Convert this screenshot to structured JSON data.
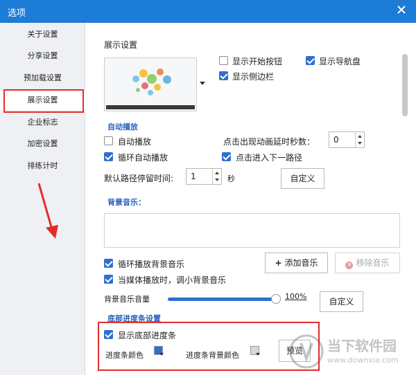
{
  "window": {
    "title": "选项"
  },
  "sidebar": {
    "items": [
      {
        "label": "关于设置"
      },
      {
        "label": "分享设置"
      },
      {
        "label": "预加载设置"
      },
      {
        "label": "展示设置"
      },
      {
        "label": "企业标志"
      },
      {
        "label": "加密设置"
      },
      {
        "label": "排练计时"
      }
    ],
    "active_index": 3
  },
  "display": {
    "section_title": "展示设置",
    "show_start_button": {
      "label": "显示开始按钮",
      "checked": false
    },
    "show_nav_panel": {
      "label": "显示导航盘",
      "checked": true
    },
    "show_sidebar": {
      "label": "显示侧边栏",
      "checked": true
    }
  },
  "autoplay": {
    "section_title": "自动播放",
    "auto_play": {
      "label": "自动播放",
      "checked": false
    },
    "loop_auto_play": {
      "label": "循环自动播放",
      "checked": true
    },
    "delay_label": "点击出现动画延时秒数：",
    "delay_value": "0",
    "click_next_path": {
      "label": "点击进入下一路径",
      "checked": true
    },
    "default_stay_label": "默认路径停留时间:",
    "default_stay_value": "1",
    "seconds_unit": "秒",
    "custom_button": "自定义"
  },
  "music": {
    "section_title": "背景音乐：",
    "loop_music": {
      "label": "循环播放背景音乐",
      "checked": true
    },
    "lower_music": {
      "label": "当媒体播放时，调小背景音乐",
      "checked": true
    },
    "add_button": "添加音乐",
    "remove_button": "移除音乐",
    "volume_label": "背景音乐音量",
    "volume_value": "100%",
    "volume_fraction": 1.0,
    "custom_button": "自定义"
  },
  "progress": {
    "section_title": "底部进度条设置",
    "show_progress": {
      "label": "显示底部进度条",
      "checked": true
    },
    "bar_color_label": "进度条颜色",
    "bar_color": "#2f6fd0",
    "bg_color_label": "进度条背景颜色",
    "bg_color": "#d8d8d8",
    "preview_button": "预览"
  },
  "watermark": {
    "text": "当下软件园",
    "url": "www.downxia.com"
  },
  "colors": {
    "titlebar": "#1d7cd6",
    "accent": "#2f6fd0",
    "highlight": "#e32b2b"
  }
}
